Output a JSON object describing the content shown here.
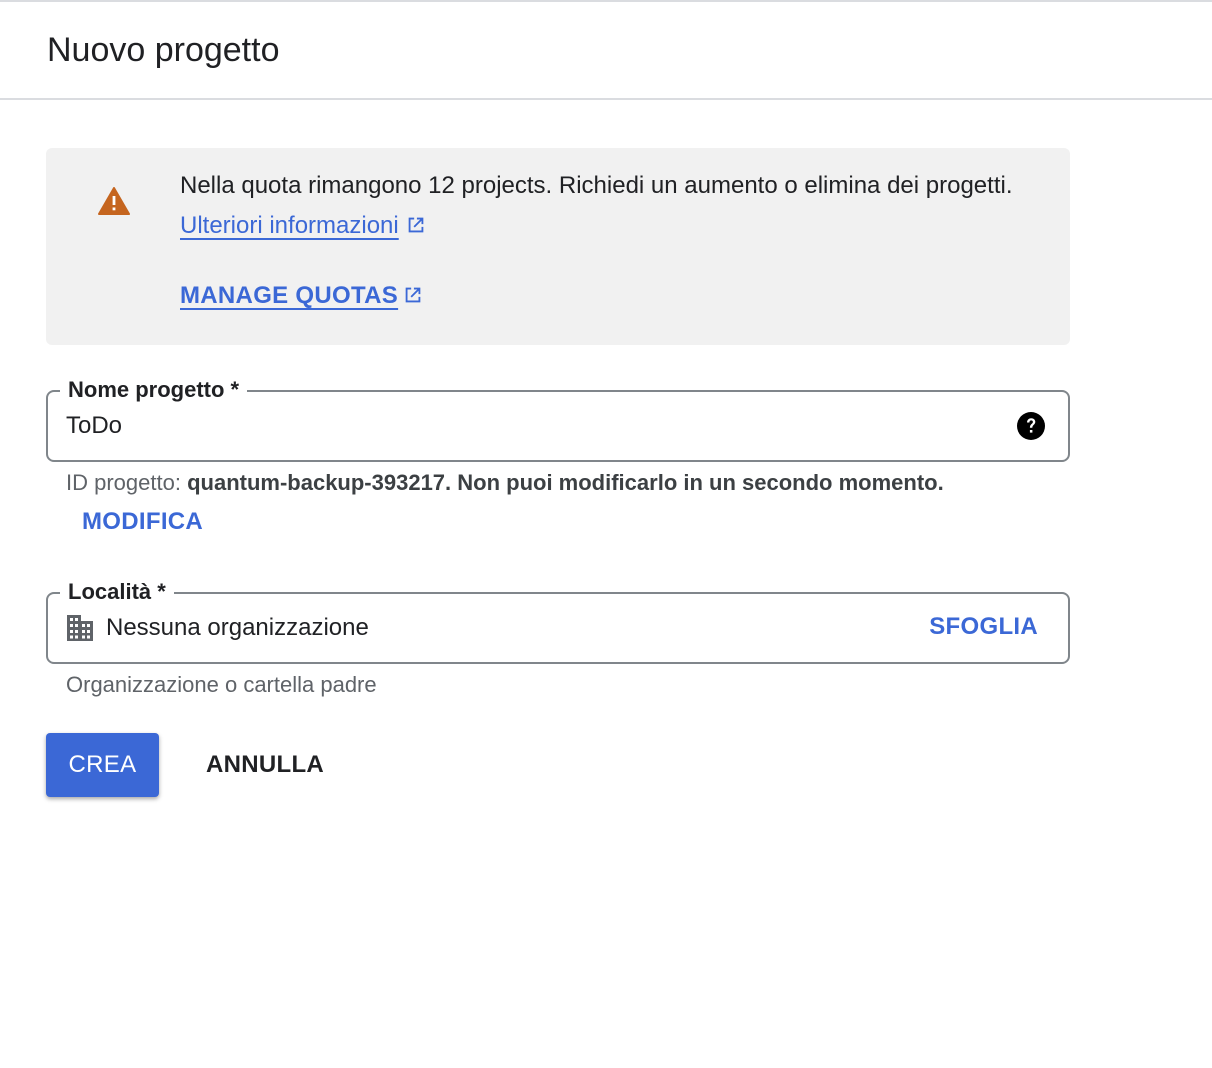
{
  "header": {
    "title": "Nuovo progetto"
  },
  "banner": {
    "text_main": "Nella quota rimangono 12 projects. Richiedi un aumento o elimina dei progetti.",
    "learn_more_link": "Ulteriori informazioni",
    "manage_quotas_link": "MANAGE QUOTAS",
    "warning_color": "#c5651f",
    "icons": {
      "warning": "warning-triangle-icon",
      "external": "open-in-new-icon"
    }
  },
  "project_name": {
    "label": "Nome progetto *",
    "value": "ToDo",
    "help_icon": "help-circle-icon",
    "helper_prefix": "ID progetto: ",
    "helper_bold": "quantum-backup-393217. Non puoi modificarlo in un secondo momento.",
    "edit_button": "MODIFICA"
  },
  "location": {
    "label": "Località *",
    "icon": "building-icon",
    "value": "Nessuna organizzazione",
    "browse_button": "SFOGLIA",
    "helper": "Organizzazione o cartella padre"
  },
  "actions": {
    "create_label": "CREA",
    "cancel_label": "ANNULLA"
  },
  "colors": {
    "primary": "#3b68d6",
    "border": "#80868b",
    "banner_bg": "#f1f1f1"
  }
}
